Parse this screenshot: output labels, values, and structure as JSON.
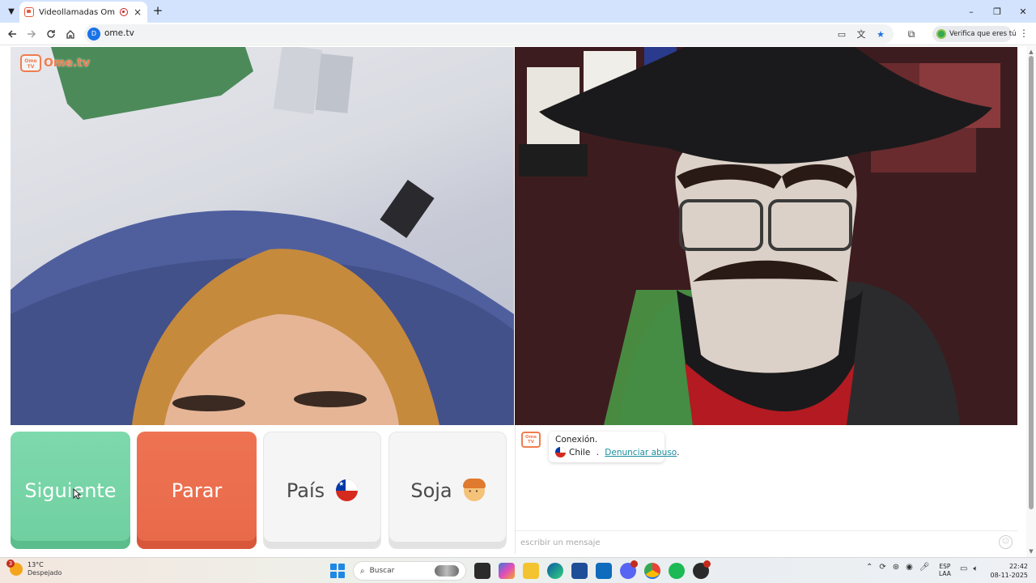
{
  "browser": {
    "tab_title": "Videollamadas OmeTV — A",
    "close_tab_glyph": "×",
    "new_tab_glyph": "+",
    "url": "ome.tv",
    "verify_chip": "Verifica que eres tú",
    "window_controls": [
      "–",
      "❐",
      "✕"
    ]
  },
  "site": {
    "logo_badge": "Ome TV",
    "logo_text": "Ome.tv"
  },
  "controls": {
    "next_label": "Siguiente",
    "stop_label": "Parar",
    "country_label": "País",
    "gender_label": "Soja",
    "colors": {
      "next": "#6fcf9f",
      "stop": "#e8694a",
      "neutral": "#f5f5f5"
    }
  },
  "chat": {
    "avatar_label": "Ome TV",
    "connection_title": "Conexión.",
    "country": "Chile",
    "separator": " . ",
    "report_link": "Denunciar abuso",
    "report_suffix": ".",
    "input_placeholder": "escribir un mensaje"
  },
  "taskbar": {
    "weather_badge": "3",
    "weather_temp": "13°C",
    "weather_desc": "Despejado",
    "search_label": "Buscar",
    "lang_line1": "ESP",
    "lang_line2": "LAA",
    "time": "22:42",
    "date": "08-11-2025"
  }
}
